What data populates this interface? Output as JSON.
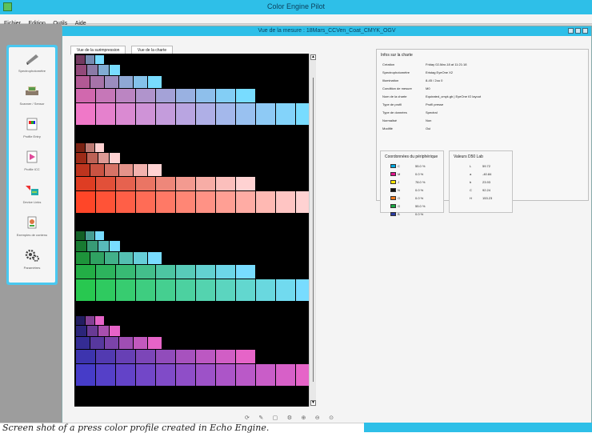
{
  "app": {
    "title": "Color Engine Pilot",
    "icon": "app-icon"
  },
  "menu": {
    "items": [
      "Fichier",
      "Edition",
      "Outils",
      "Aide"
    ]
  },
  "window": {
    "title": "Vue de la mesure : 18Mars_CCVen_Coat_CMYK_OGV"
  },
  "tabs": [
    {
      "label": "Vue de la surimpression"
    },
    {
      "label": "Vue de la charte"
    }
  ],
  "sidebar": {
    "items": [
      {
        "label": "Spectrophotomètre",
        "icon": "spectrophotometer-icon"
      },
      {
        "label": "Scanner / Sensor",
        "icon": "scanner-icon"
      },
      {
        "label": "Profile Entry",
        "icon": "profile-entry-icon"
      },
      {
        "label": "Profile ICC",
        "icon": "profile-icc-icon"
      },
      {
        "label": "Device Links",
        "icon": "device-link-icon"
      },
      {
        "label": "Exemples de contenu",
        "icon": "examples-icon"
      },
      {
        "label": "Paramètres",
        "icon": "gears-icon"
      }
    ]
  },
  "chart_info": {
    "title": "Infos sur la charte",
    "rows": [
      {
        "label": "Création",
        "value": "Friday 02-Mar-18 at 11:21:18"
      },
      {
        "label": "Spectrophotomètre",
        "value": "Eristag EyeOne X2"
      },
      {
        "label": "Illumination",
        "value": "8-45 / 2ou 0"
      },
      {
        "label": "Condition de mesure",
        "value": "M0"
      },
      {
        "label": "Nom de la charte",
        "value": "Equirated_cmyk.gb | EyeOne IO layout"
      },
      {
        "label": "Type de profil",
        "value": "Profil presse"
      },
      {
        "label": "Type de données",
        "value": "Spectral"
      },
      {
        "label": "Normalisé",
        "value": "Non"
      },
      {
        "label": "Modifié",
        "value": "Oui"
      }
    ]
  },
  "peripheral": {
    "title": "Coordonnées du périphérique",
    "rows": [
      {
        "chan": "C",
        "value": "55.0 %",
        "color": "#00a9e0"
      },
      {
        "chan": "M",
        "value": "0.0 %",
        "color": "#e0148c"
      },
      {
        "chan": "J",
        "value": "78.0 %",
        "color": "#ffe600"
      },
      {
        "chan": "N",
        "value": "0.0 %",
        "color": "#111111"
      },
      {
        "chan": "O",
        "value": "0.0 %",
        "color": "#f07a1c"
      },
      {
        "chan": "G",
        "value": "55.0 %",
        "color": "#1aa844"
      },
      {
        "chan": "B",
        "value": "0.0 %",
        "color": "#2a3aa0"
      }
    ]
  },
  "lab_values": {
    "title": "Valeurs D50 Lab",
    "rows": [
      {
        "label": "L",
        "value": "59.72"
      },
      {
        "label": "a",
        "value": "-40.84"
      },
      {
        "label": "b",
        "value": "23.93"
      },
      {
        "label": "C",
        "value": "92.24"
      },
      {
        "label": "H",
        "value": "153.23"
      }
    ]
  },
  "toolbar": {
    "icons": [
      "rotate-icon",
      "edit-icon",
      "select-icon",
      "gear-icon",
      "zoom-in-icon",
      "zoom-out-icon",
      "zoom-fit-icon"
    ]
  },
  "caption": {
    "text": "Screen shot of a press color profile created in Echo Engine."
  }
}
